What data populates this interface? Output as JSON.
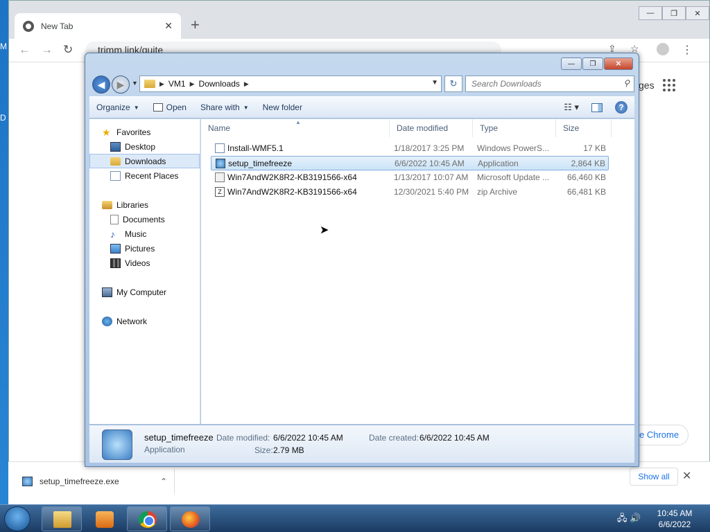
{
  "desktop": {
    "frag_m": "M",
    "frag_d": "D"
  },
  "chrome": {
    "tab_title": "New Tab",
    "tab_close": "✕",
    "new_tab": "+",
    "omnibox_text": "trimm.link/quite",
    "back": "←",
    "forward": "→",
    "reload": "↻",
    "share": "⇪",
    "bookmark": "☆",
    "menu": "⋮",
    "body_frag": "ges",
    "pill_text": "e Chrome",
    "win_min": "—",
    "win_max": "❐",
    "win_close": "✕"
  },
  "shelf": {
    "filename": "setup_timefreeze.exe",
    "chevron": "⌃",
    "show_all": "Show all",
    "close": "✕"
  },
  "explorer": {
    "win_min": "—",
    "win_max": "❐",
    "win_close": "✕",
    "breadcrumb": [
      "VM1",
      "Downloads"
    ],
    "search_placeholder": "Search Downloads",
    "toolbar": {
      "organize": "Organize",
      "open": "Open",
      "share_with": "Share with",
      "new_folder": "New folder"
    },
    "nav": {
      "favorites": "Favorites",
      "desktop": "Desktop",
      "downloads": "Downloads",
      "recent_places": "Recent Places",
      "libraries": "Libraries",
      "documents": "Documents",
      "music": "Music",
      "pictures": "Pictures",
      "videos": "Videos",
      "my_computer": "My Computer",
      "network": "Network"
    },
    "columns": {
      "name": "Name",
      "date": "Date modified",
      "type": "Type",
      "size": "Size"
    },
    "files": [
      {
        "name": "Install-WMF5.1",
        "date": "1/18/2017 3:25 PM",
        "type": "Windows PowerS...",
        "size": "17 KB"
      },
      {
        "name": "setup_timefreeze",
        "date": "6/6/2022 10:45 AM",
        "type": "Application",
        "size": "2,864 KB"
      },
      {
        "name": "Win7AndW2K8R2-KB3191566-x64",
        "date": "1/13/2017 10:07 AM",
        "type": "Microsoft Update ...",
        "size": "66,460 KB"
      },
      {
        "name": "Win7AndW2K8R2-KB3191566-x64",
        "date": "12/30/2021 5:40 PM",
        "type": "zip Archive",
        "size": "66,481 KB"
      }
    ],
    "details": {
      "name": "setup_timefreeze",
      "type": "Application",
      "date_modified_label": "Date modified:",
      "date_modified": "6/6/2022 10:45 AM",
      "date_created_label": "Date created:",
      "date_created": "6/6/2022 10:45 AM",
      "size_label": "Size:",
      "size": "2.79 MB"
    }
  },
  "taskbar": {
    "time": "10:45 AM",
    "date": "6/6/2022"
  },
  "colors": {
    "accent": "#1a73e8",
    "selection": "#cbe4f8",
    "taskbar": "#1b3b62"
  }
}
